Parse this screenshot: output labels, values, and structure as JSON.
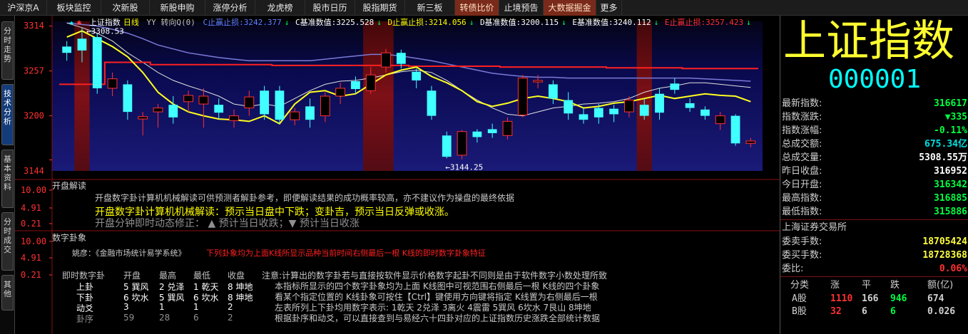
{
  "menu": {
    "items": [
      "沪深京A",
      "板块监控",
      "次新股",
      "新股申购",
      "涨停分析",
      "龙虎榜",
      "股市日历",
      "股指期货",
      "新三板",
      "转债比价",
      "止境预告",
      "大数据掘金",
      "更多"
    ]
  },
  "left_tabs": [
    "分时走势",
    "技术分析",
    "基本资料",
    "分时成交",
    "其他"
  ],
  "infobar": {
    "name": "上证指数",
    "period": "日线",
    "yy": "YY 转向Q(0)",
    "c_stop_label": "C止赢止损:",
    "c_stop_val": "3242.377",
    "c_base_label": "C基准数值:",
    "c_base_val": "3225.528",
    "d_stop_label": "D止赢止损:",
    "d_stop_val": "3214.056",
    "d_base_label": "D基准数值:",
    "d_base_val": "3200.115",
    "e_base_label": "E基准数值:",
    "e_base_val": "3240.112",
    "e_stop_label": "E止赢止损:",
    "e_stop_val": "3257.423"
  },
  "chart_data": {
    "type": "candlestick",
    "y_ticks": [
      "3314",
      "3257",
      "3200",
      "3144"
    ],
    "ylim": [
      3130,
      3320
    ],
    "annotations": {
      "high": "3308.53",
      "low": "3144.25"
    },
    "candles": [
      {
        "o": 3280,
        "c": 3288,
        "h": 3295,
        "l": 3270,
        "up": false
      },
      {
        "o": 3298,
        "c": 3283,
        "h": 3312,
        "l": 3268,
        "up": false
      },
      {
        "o": 3300,
        "c": 3235,
        "h": 3305,
        "l": 3228,
        "up": false
      },
      {
        "o": 3235,
        "c": 3247,
        "h": 3255,
        "l": 3225,
        "up": true
      },
      {
        "o": 3240,
        "c": 3205,
        "h": 3245,
        "l": 3195,
        "up": false
      },
      {
        "o": 3196,
        "c": 3199,
        "h": 3205,
        "l": 3175,
        "up": true
      },
      {
        "o": 3205,
        "c": 3210,
        "h": 3215,
        "l": 3185,
        "up": true
      },
      {
        "o": 3214,
        "c": 3198,
        "h": 3225,
        "l": 3190,
        "up": false
      },
      {
        "o": 3218,
        "c": 3226,
        "h": 3232,
        "l": 3205,
        "up": true
      },
      {
        "o": 3215,
        "c": 3225,
        "h": 3235,
        "l": 3185,
        "up": true
      },
      {
        "o": 3214,
        "c": 3204,
        "h": 3222,
        "l": 3196,
        "up": false
      },
      {
        "o": 3194,
        "c": 3200,
        "h": 3208,
        "l": 3185,
        "up": true
      },
      {
        "o": 3210,
        "c": 3224,
        "h": 3232,
        "l": 3200,
        "up": true
      },
      {
        "o": 3232,
        "c": 3202,
        "h": 3238,
        "l": 3195,
        "up": false
      },
      {
        "o": 3232,
        "c": 3195,
        "h": 3238,
        "l": 3190,
        "up": false
      },
      {
        "o": 3195,
        "c": 3205,
        "h": 3210,
        "l": 3188,
        "up": true
      },
      {
        "o": 3212,
        "c": 3195,
        "h": 3222,
        "l": 3185,
        "up": false
      },
      {
        "o": 3200,
        "c": 3225,
        "h": 3230,
        "l": 3192,
        "up": true
      },
      {
        "o": 3225,
        "c": 3235,
        "h": 3242,
        "l": 3215,
        "up": true
      },
      {
        "o": 3244,
        "c": 3234,
        "h": 3250,
        "l": 3228,
        "up": false
      },
      {
        "o": 3232,
        "c": 3252,
        "h": 3262,
        "l": 3228,
        "up": true
      },
      {
        "o": 3262,
        "c": 3280,
        "h": 3285,
        "l": 3255,
        "up": true
      },
      {
        "o": 3280,
        "c": 3266,
        "h": 3284,
        "l": 3260,
        "up": false
      },
      {
        "o": 3256,
        "c": 3245,
        "h": 3260,
        "l": 3235,
        "up": false
      },
      {
        "o": 3232,
        "c": 3200,
        "h": 3238,
        "l": 3195,
        "up": false
      },
      {
        "o": 3175,
        "c": 3148,
        "h": 3180,
        "l": 3146,
        "up": false
      },
      {
        "o": 3150,
        "c": 3180,
        "h": 3182,
        "l": 3145,
        "up": true
      },
      {
        "o": 3180,
        "c": 3173,
        "h": 3183,
        "l": 3166,
        "up": false
      },
      {
        "o": 3183,
        "c": 3178,
        "h": 3190,
        "l": 3172,
        "up": false
      },
      {
        "o": 3175,
        "c": 3193,
        "h": 3198,
        "l": 3170,
        "up": true
      },
      {
        "o": 3201,
        "c": 3248,
        "h": 3252,
        "l": 3198,
        "up": true
      },
      {
        "o": 3245,
        "c": 3243,
        "h": 3252,
        "l": 3235,
        "up": true
      },
      {
        "o": 3240,
        "c": 3222,
        "h": 3245,
        "l": 3215,
        "up": false
      },
      {
        "o": 3220,
        "c": 3203,
        "h": 3230,
        "l": 3195,
        "up": false
      },
      {
        "o": 3202,
        "c": 3195,
        "h": 3210,
        "l": 3190,
        "up": false
      },
      {
        "o": 3210,
        "c": 3198,
        "h": 3215,
        "l": 3190,
        "up": false
      },
      {
        "o": 3209,
        "c": 3202,
        "h": 3214,
        "l": 3192,
        "up": false
      },
      {
        "o": 3205,
        "c": 3220,
        "h": 3225,
        "l": 3198,
        "up": true
      },
      {
        "o": 3214,
        "c": 3200,
        "h": 3222,
        "l": 3195,
        "up": false
      },
      {
        "o": 3228,
        "c": 3204,
        "h": 3235,
        "l": 3195,
        "up": false
      },
      {
        "o": 3241,
        "c": 3233,
        "h": 3248,
        "l": 3228,
        "up": false
      },
      {
        "o": 3216,
        "c": 3210,
        "h": 3222,
        "l": 3205,
        "up": false
      },
      {
        "o": 3208,
        "c": 3200,
        "h": 3212,
        "l": 3195,
        "up": false
      },
      {
        "o": 3200,
        "c": 3190,
        "h": 3205,
        "l": 3182,
        "up": true
      },
      {
        "o": 3200,
        "c": 3165,
        "h": 3202,
        "l": 3162,
        "up": false
      },
      {
        "o": 3168,
        "c": 3165,
        "h": 3172,
        "l": 3160,
        "up": true
      }
    ],
    "lines": {
      "red_step": [
        3240,
        3240,
        3240,
        3268,
        3268,
        3268,
        3265,
        3265,
        3265,
        3265,
        3265,
        3265,
        3265,
        3265,
        3264,
        3264,
        3264,
        3264,
        3264,
        3264,
        3264,
        3264,
        3264,
        3263,
        3263,
        3263,
        3263,
        3263,
        3263,
        3262,
        3262,
        3262,
        3262,
        3262,
        3262,
        3262,
        3261,
        3261,
        3261,
        3261,
        3261,
        3260,
        3260,
        3260,
        3260,
        3260
      ],
      "yellow": [
        3300,
        3308,
        3298,
        3288,
        3275,
        3255,
        3230,
        3215,
        3205,
        3200,
        3196,
        3195,
        3193,
        3200,
        3190,
        3215,
        3230,
        3232,
        3225,
        3228,
        3240,
        3252,
        3258,
        3262,
        3250,
        3242,
        3232,
        3218,
        3212,
        3216,
        3222,
        3225,
        3222,
        3218,
        3210,
        3212,
        3216,
        3218,
        3222,
        3226,
        3222,
        3225,
        3228,
        3226,
        3225,
        3218
      ],
      "white": [
        3318,
        3312,
        3305,
        3295,
        3280,
        3268,
        3255,
        3245,
        3238,
        3232,
        3225,
        3215,
        3212,
        3215,
        3212,
        3222,
        3232,
        3240,
        3244,
        3245,
        3248,
        3252,
        3256,
        3258,
        3255,
        3245,
        3232,
        3220,
        3210,
        3202,
        3200,
        3205,
        3210,
        3212,
        3215,
        3216,
        3218,
        3222,
        3230,
        3235,
        3238,
        3242,
        3242,
        3240,
        3238,
        3236
      ],
      "blue": [
        3318,
        3316,
        3314,
        3310,
        3305,
        3298,
        3290,
        3285,
        3280,
        3277,
        3274,
        3272,
        3270,
        3270,
        3270,
        3270,
        3270,
        3272,
        3274,
        3276,
        3278,
        3278,
        3276,
        3273,
        3270,
        3266,
        3262,
        3258,
        3254,
        3252,
        3250,
        3249,
        3249,
        3248,
        3248,
        3248,
        3248,
        3248,
        3248,
        3248,
        3248,
        3248,
        3247,
        3246,
        3245,
        3244
      ]
    },
    "sub1_ticks": [
      "10.00",
      "4.91",
      "0.21"
    ],
    "sub2_ticks": [
      "10.00",
      "4.91",
      "0.21"
    ]
  },
  "section1": {
    "title": "开盘解读",
    "line1": "开盘数字卦计算机机械解读可供预测者解卦参考，即便解读结果的成功概率较高，亦不建议作为操盘的最终依据",
    "line2": "开盘数字卦计算机机械解读：预示当日盘中下跌；变卦吉，预示当日反弹或收涨。",
    "line3": "开盘分钟即时动态修正：  ▲ 预计当日收跌；▼ 预计当日收涨"
  },
  "section2": {
    "title": "数字卦象",
    "desc_prefix": "姚彦：《金融市场统计易学系统》",
    "desc_red": "下列卦象均为上面K线所显示品种当前时间右侧最后一根 K线的即时数字卦象特征",
    "headers": [
      "即时数字卦",
      "开盘",
      "最高",
      "最低",
      "收盘"
    ],
    "rows": [
      [
        "上卦",
        "5 巽风",
        "2 兑泽",
        "1 乾天",
        "8 坤地"
      ],
      [
        "下卦",
        "6 坎水",
        "5 巽风",
        "6 坎水",
        "8 坤地"
      ],
      [
        "动爻",
        "3",
        "1",
        "1",
        "2"
      ],
      [
        "卦序",
        "59",
        "28",
        "6",
        "2"
      ]
    ],
    "notes": [
      "注意:计算出的数字卦若与直接按软件显示价格数字起卦不同则是由于软件数字小数处理所致",
      "本指标所显示的四个数字卦象均为上面 K线图中可视范围右侧最后一根 K线的四个卦象",
      "看某个指定位置的 K线卦象可按住【Ctrl】键使用方向键将指定 K线置为右侧最后一根",
      "左表所列上下卦均用数字表示:  1乾天 2兑泽 3离火 4震雷 5巽风 6坎水 7艮山 8坤地",
      "根据卦序和动爻，可以直接查到与易经六十四卦对应的上证指数历史涨跌全部统计数据"
    ]
  },
  "right": {
    "big_name": "上证指数",
    "code": "000001",
    "stats": [
      {
        "label": "最新指数:",
        "value": "316617",
        "color": "#00ff40"
      },
      {
        "label": "指数涨跌:",
        "value": "▼335",
        "color": "#00ff40"
      },
      {
        "label": "指数涨幅:",
        "value": "-0.11%",
        "color": "#00ff40"
      },
      {
        "label": "总成交额:",
        "value": "675.34亿",
        "color": "#00e0e0"
      },
      {
        "label": "总成交量:",
        "value": "5308.55万",
        "color": "#ffffff"
      },
      {
        "label": "昨日收盘:",
        "value": "316952",
        "color": "#ffffff"
      },
      {
        "label": "今日开盘:",
        "value": "316342",
        "color": "#00ff40"
      },
      {
        "label": "最高指数:",
        "value": "316885",
        "color": "#00ff40"
      },
      {
        "label": "最低指数:",
        "value": "315886",
        "color": "#00ff40"
      }
    ],
    "exchange": "上海证券交易所",
    "orders": [
      {
        "label": "委卖手数:",
        "value": "18705424",
        "color": "#ffff40"
      },
      {
        "label": "委买手数:",
        "value": "18728368",
        "color": "#ffff40"
      },
      {
        "label": "委比:",
        "value": "0.06%",
        "color": "#ff3030"
      }
    ],
    "table_headers": [
      "分类",
      "涨",
      "平",
      "跌",
      "额(亿)"
    ],
    "table_rows": [
      [
        "A股",
        "1110",
        "166",
        "946",
        "674"
      ],
      [
        "B股",
        "32",
        "6",
        "6",
        "0.026"
      ]
    ]
  }
}
